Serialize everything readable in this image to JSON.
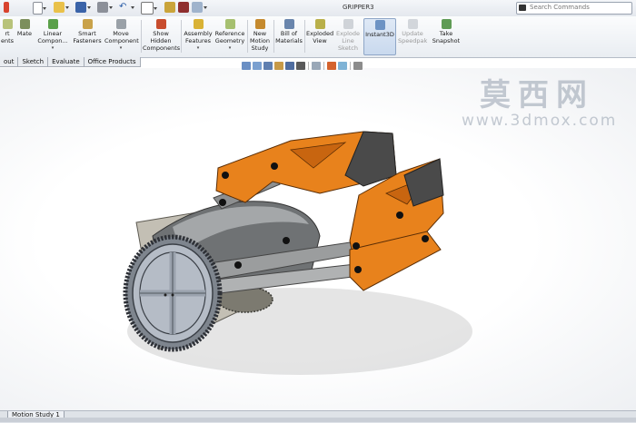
{
  "window": {
    "title": "GRIPPER3"
  },
  "search": {
    "placeholder": "Search Commands"
  },
  "commands": [
    {
      "label": "rt ents",
      "name": "insert-components"
    },
    {
      "label": "Mate",
      "name": "mate"
    },
    {
      "label": "Linear Compon...",
      "name": "linear-component-pattern"
    },
    {
      "label": "Smart Fasteners",
      "name": "smart-fasteners"
    },
    {
      "label": "Move Component",
      "name": "move-component"
    },
    {
      "label": "Show Hidden Components",
      "name": "show-hidden-components"
    },
    {
      "label": "Assembly Features",
      "name": "assembly-features"
    },
    {
      "label": "Reference Geometry",
      "name": "reference-geometry"
    },
    {
      "label": "New Motion Study",
      "name": "new-motion-study"
    },
    {
      "label": "Bill of Materials",
      "name": "bill-of-materials"
    },
    {
      "label": "Exploded View",
      "name": "exploded-view"
    },
    {
      "label": "Explode Line Sketch",
      "name": "explode-line-sketch"
    },
    {
      "label": "Instant3D",
      "name": "instant3d"
    },
    {
      "label": "Update Speedpak",
      "name": "update-speedpak"
    },
    {
      "label": "Take Snapshot",
      "name": "take-snapshot"
    }
  ],
  "tabs": [
    "out",
    "Sketch",
    "Evaluate",
    "Office Products"
  ],
  "bottom_tab": "Motion Study 1",
  "watermark": {
    "chinese": "莫西网",
    "url": "www.3dmox.com"
  },
  "colors": {
    "part_orange": "#e8821c",
    "part_gray": "#8a8d8f",
    "selected_cmd": "#c9d9ee"
  }
}
